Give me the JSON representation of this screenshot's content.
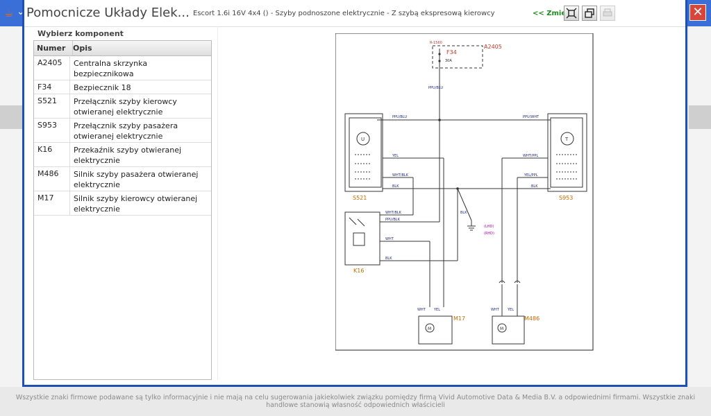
{
  "window": {
    "title": "Pomocnicze Układy Elek...",
    "subtitle": "Escort 1.6i 16V 4x4 () - Szyby podnoszone elektrycznie - Z szybą ekspresową kierowcy",
    "change_link": "<< Zmie"
  },
  "panel": {
    "heading": "Wybierz komponent",
    "columns": {
      "number": "Numer",
      "description": "Opis"
    },
    "rows": [
      {
        "number": "A2405",
        "description": "Centralna skrzynka bezpiecznikowa"
      },
      {
        "number": "F34",
        "description": "Bezpiecznik 18"
      },
      {
        "number": "S521",
        "description": "Przełącznik szyby kierowcy otwieranej elektrycznie"
      },
      {
        "number": "S953",
        "description": "Przełącznik szyby pasażera otwieranej elektrycznie"
      },
      {
        "number": "K16",
        "description": "Przekaźnik szyby otwieranej elektrycznie"
      },
      {
        "number": "M486",
        "description": "Silnik szyby pasażera otwieranej elektrycznie"
      },
      {
        "number": "M17",
        "description": "Silnik szyby kierowcy otwieranej elektrycznie"
      }
    ]
  },
  "diagram": {
    "labels": {
      "a2405": "A2405",
      "f34": "F34",
      "f34_top": "R-1560",
      "f34_rating": "30A",
      "ppu_blu": "PPU/BLU",
      "ppu_blu_stack": "PPU\nBLU",
      "s521": "S521",
      "s953": "S953",
      "k16": "K16",
      "m17": "M17",
      "m486": "M486",
      "yel": "YEL",
      "wht_blk": "WHT/BLK",
      "blk": "BLK",
      "ppu_wht": "PPU/WHT",
      "wht_ppl": "WHT/PPL",
      "yel_ppl": "YEL/PPL",
      "ppu_blk": "PPU/BLK",
      "wht": "WHT",
      "lhd": "(LHD)",
      "rhd": "(RHD)"
    },
    "colors": {
      "component": "#c0392b",
      "wire": "#1f2a7a",
      "note": "#b000b0",
      "tag": "#c46a00"
    }
  },
  "footer": {
    "text": "Wszystkie znaki firmowe podawane są tylko informacyjnie i nie mają na celu sugerowania jakiekolwiek związku pomiędzy firmą Vivid Automotive Data & Media B.V. a odpowiednimi firmami. Wszystkie znaki handlowe stanowią własność odpowiednich właścicieli"
  }
}
